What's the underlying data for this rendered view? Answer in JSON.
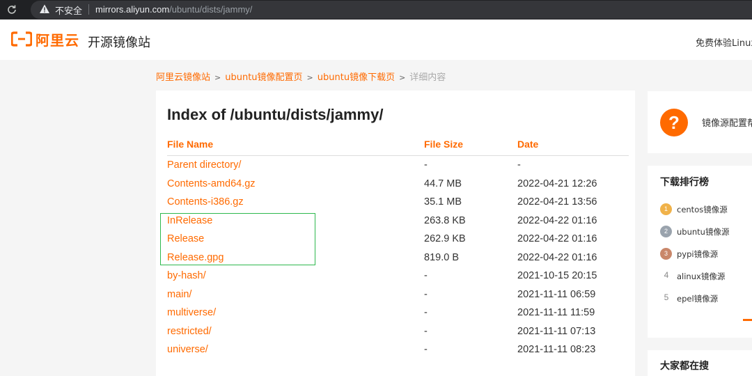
{
  "browser": {
    "security_label": "不安全",
    "url_host": "mirrors.aliyun.com",
    "url_path": "/ubuntu/dists/jammy/"
  },
  "header": {
    "logo_text": "阿里云",
    "site_title": "开源镜像站",
    "trial_link": "免费体验Linux",
    "brand_color": "#ff6a00"
  },
  "breadcrumb": {
    "items": [
      "阿里云镜像站",
      "ubuntu镜像配置页",
      "ubuntu镜像下载页"
    ],
    "separator": ">",
    "current": "详细内容"
  },
  "listing": {
    "title": "Index of /ubuntu/dists/jammy/",
    "columns": [
      "File Name",
      "File Size",
      "Date"
    ],
    "rows": [
      {
        "name": "Parent directory/",
        "size": "-",
        "date": "-"
      },
      {
        "name": "Contents-amd64.gz",
        "size": "44.7 MB",
        "date": "2022-04-21 12:26"
      },
      {
        "name": "Contents-i386.gz",
        "size": "35.1 MB",
        "date": "2022-04-21 13:56"
      },
      {
        "name": "InRelease",
        "size": "263.8 KB",
        "date": "2022-04-22 01:16"
      },
      {
        "name": "Release",
        "size": "262.9 KB",
        "date": "2022-04-22 01:16"
      },
      {
        "name": "Release.gpg",
        "size": "819.0 B",
        "date": "2022-04-22 01:16"
      },
      {
        "name": "by-hash/",
        "size": "-",
        "date": "2021-10-15 20:15"
      },
      {
        "name": "main/",
        "size": "-",
        "date": "2021-11-11 06:59"
      },
      {
        "name": "multiverse/",
        "size": "-",
        "date": "2021-11-11 11:59"
      },
      {
        "name": "restricted/",
        "size": "-",
        "date": "2021-11-11 07:13"
      },
      {
        "name": "universe/",
        "size": "-",
        "date": "2021-11-11 08:23"
      }
    ],
    "highlight_color": "#2db84d"
  },
  "sidebar": {
    "help": {
      "icon": "question-icon",
      "text": "镜像源配置帮"
    },
    "ranking": {
      "title": "下载排行榜",
      "items": [
        {
          "rank": "1",
          "name": "centos镜像源",
          "medal": "gold-medal-icon"
        },
        {
          "rank": "2",
          "name": "ubuntu镜像源",
          "medal": "silver-medal-icon"
        },
        {
          "rank": "3",
          "name": "pypi镜像源",
          "medal": "bronze-medal-icon"
        },
        {
          "rank": "4",
          "name": "alinux镜像源"
        },
        {
          "rank": "5",
          "name": "epel镜像源"
        }
      ]
    },
    "popular_search": {
      "title": "大家都在搜"
    }
  }
}
